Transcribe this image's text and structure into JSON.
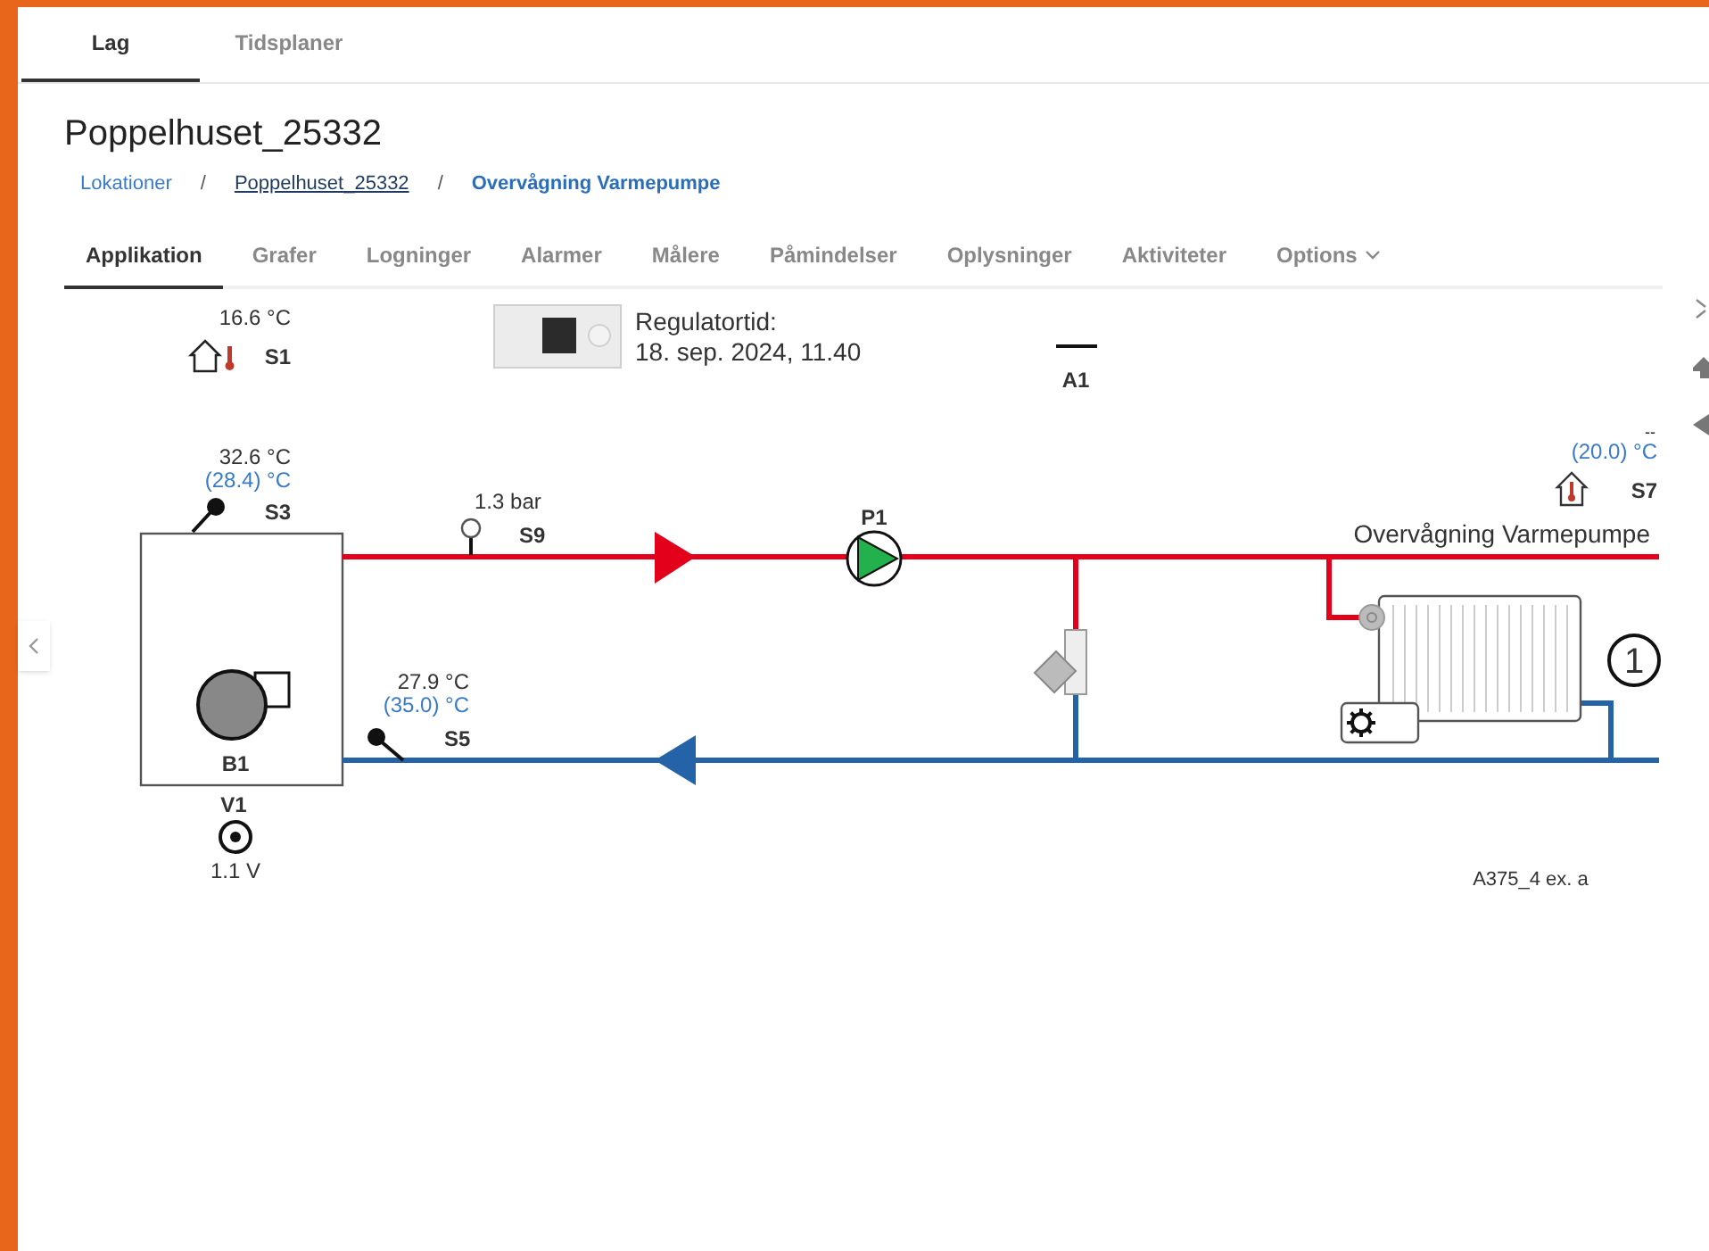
{
  "top_tabs": [
    {
      "label": "Lag",
      "selected": true
    },
    {
      "label": "Tidsplaner",
      "selected": false
    }
  ],
  "title": "Poppelhuset_25332",
  "breadcrumb": [
    {
      "label": "Lokationer",
      "kind": "link"
    },
    {
      "label": "Poppelhuset_25332",
      "kind": "underlined",
      "separator": "/"
    },
    {
      "label": "Overvågning Varmepumpe",
      "kind": "current",
      "separator": "/"
    }
  ],
  "nav_tabs": [
    {
      "label": "Applikation",
      "selected": true,
      "kind": "tab"
    },
    {
      "label": "Grafer",
      "selected": false,
      "kind": "tab"
    },
    {
      "label": "Logninger",
      "selected": false,
      "kind": "tab"
    },
    {
      "label": "Alarmer",
      "selected": false,
      "kind": "tab"
    },
    {
      "label": "Målere",
      "selected": false,
      "kind": "tab"
    },
    {
      "label": "Påmindelser",
      "selected": false,
      "kind": "tab"
    },
    {
      "label": "Oplysninger",
      "selected": false,
      "kind": "tab"
    },
    {
      "label": "Aktiviteter",
      "selected": false,
      "kind": "tab"
    },
    {
      "label": "Options",
      "selected": false,
      "kind": "dropdown"
    }
  ],
  "diagram": {
    "regulator": {
      "label": "Regulatortid:",
      "time": "18. sep. 2024, 11.40"
    },
    "outdoor_sensor": {
      "reading": "16.6 °C",
      "label": "S1"
    },
    "output": {
      "label": "A1"
    },
    "flow_sensor": {
      "reading": "32.6 °C",
      "setpoint": "(28.4) °C",
      "label": "S3"
    },
    "pressure_sensor": {
      "reading": "1.3 bar",
      "label": "S9"
    },
    "pump": {
      "label": "P1",
      "running": true
    },
    "room_sensor": {
      "reading": "--",
      "setpoint": "(20.0) °C",
      "label": "S7"
    },
    "circuit": {
      "name": "Overvågning Varmepumpe",
      "number": "1"
    },
    "return_sensor": {
      "reading": "27.9 °C",
      "setpoint": "(35.0) °C",
      "label": "S5"
    },
    "boiler": {
      "label": "B1"
    },
    "signal": {
      "label": "V1",
      "reading": "1.1 V"
    },
    "diagram_code": "A375_4 ex. a"
  }
}
